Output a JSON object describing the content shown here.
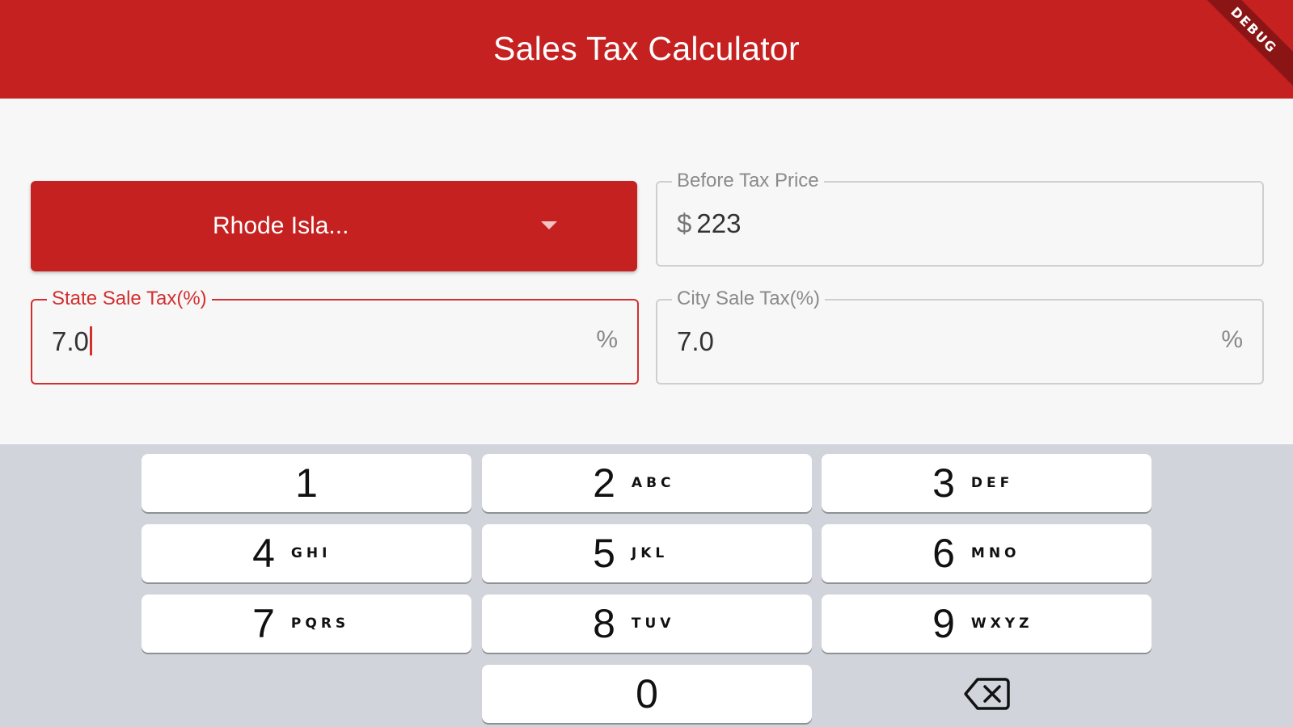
{
  "appbar": {
    "title": "Sales Tax Calculator",
    "debug_label": "DEBUG"
  },
  "form": {
    "state_dropdown": {
      "selected": "Rhode Isla..."
    },
    "before_tax_price": {
      "label": "Before Tax Price",
      "prefix": "$",
      "value": "223"
    },
    "state_tax": {
      "label": "State Sale Tax(%)",
      "value": "7.0",
      "suffix": "%"
    },
    "city_tax": {
      "label": "City Sale Tax(%)",
      "value": "7.0",
      "suffix": "%"
    }
  },
  "keyboard": {
    "keys": [
      {
        "digit": "1",
        "letters": ""
      },
      {
        "digit": "2",
        "letters": "ABC"
      },
      {
        "digit": "3",
        "letters": "DEF"
      },
      {
        "digit": "4",
        "letters": "GHI"
      },
      {
        "digit": "5",
        "letters": "JKL"
      },
      {
        "digit": "6",
        "letters": "MNO"
      },
      {
        "digit": "7",
        "letters": "PQRS"
      },
      {
        "digit": "8",
        "letters": "TUV"
      },
      {
        "digit": "9",
        "letters": "WXYZ"
      },
      {
        "digit": "0",
        "letters": ""
      }
    ],
    "delete_icon": "backspace-icon"
  },
  "colors": {
    "primary": "#c62121",
    "focus": "#d32f2f",
    "keyboard_bg": "#d1d4da"
  }
}
